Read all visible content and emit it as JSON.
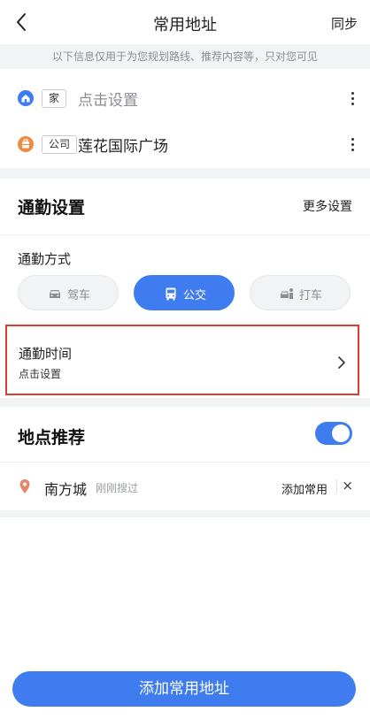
{
  "header": {
    "title": "常用地址",
    "sync_label": "同步"
  },
  "notice": "以下信息仅用于为您规划路线、推荐内容等，只对您可见",
  "addresses": [
    {
      "tag": "家",
      "text": "点击设置",
      "icon": "home-icon",
      "is_set": false,
      "icon_color": "#3f7cf0"
    },
    {
      "tag": "公司",
      "text": "莲花国际广场",
      "icon": "company-icon",
      "is_set": true,
      "icon_color": "#f08a3c"
    }
  ],
  "commute": {
    "section_title": "通勤设置",
    "more_label": "更多设置",
    "mode_label": "通勤方式",
    "modes": [
      {
        "label": "驾车",
        "icon": "car-icon",
        "active": false
      },
      {
        "label": "公交",
        "icon": "bus-icon",
        "active": true
      },
      {
        "label": "打车",
        "icon": "taxi-icon",
        "active": false
      }
    ],
    "time_title": "通勤时间",
    "time_sub": "点击设置"
  },
  "recommend": {
    "section_title": "地点推荐",
    "toggle_on": true,
    "place": {
      "name": "南方城",
      "time": "刚刚搜过",
      "add_label": "添加常用",
      "close_glyph": "×"
    }
  },
  "bottom_button": "添加常用地址",
  "colors": {
    "accent": "#3f7cf0",
    "highlight_border": "#e03a35",
    "pin": "#e8836c"
  }
}
